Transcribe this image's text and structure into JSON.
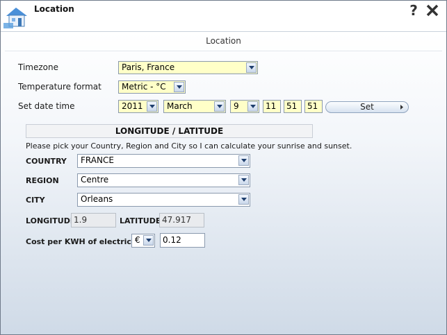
{
  "window": {
    "title": "Location"
  },
  "section": {
    "header": "Location"
  },
  "timezone": {
    "label": "Timezone",
    "value": "Paris, France"
  },
  "temperature": {
    "label": "Temperature format",
    "value": "Metric - °C"
  },
  "datetime": {
    "label": "Set date time",
    "year": "2011",
    "month": "March",
    "day": "9",
    "hour": "11",
    "minute": "51",
    "second": "51",
    "set_label": "Set"
  },
  "geo": {
    "title": "LONGITUDE / LATITUDE",
    "instruction": "Please pick your Country, Region and City so I can calculate your sunrise and sunset.",
    "country_label": "COUNTRY",
    "country": "FRANCE",
    "region_label": "REGION",
    "region": "Centre",
    "city_label": "CITY",
    "city": "Orleans",
    "longitude_label": "LONGITUDE",
    "longitude": "1.9",
    "latitude_label": "LATITUDE",
    "latitude": "47.917"
  },
  "cost": {
    "label": "Cost per KWH of electricity",
    "currency": "€",
    "value": "0.12"
  },
  "icons": {
    "app": "house-icon",
    "help": "help-icon",
    "close": "close-icon"
  },
  "colors": {
    "field_bg": "#ffffc8",
    "accent_border": "#8a99ad"
  }
}
